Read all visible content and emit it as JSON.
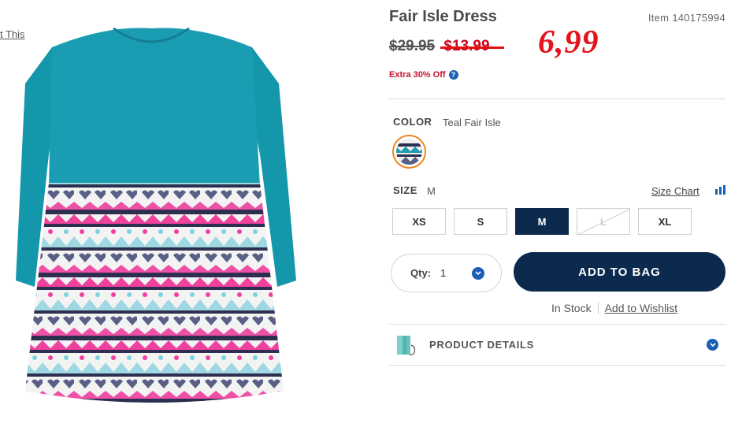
{
  "page": {
    "print_link": "t This"
  },
  "product": {
    "title": "Fair Isle Dress",
    "item_number": "Item 140175994",
    "price_original": "$29.95",
    "price_sale": "$13.99",
    "price_handwritten": "6,99",
    "extra_offer": "Extra 30% Off",
    "help_icon_glyph": "?"
  },
  "color": {
    "label": "COLOR",
    "value": "Teal Fair Isle",
    "swatch_icon": "fabric-swatch-icon"
  },
  "size": {
    "label": "SIZE",
    "selected": "M",
    "chart_label": "Size Chart",
    "options": [
      {
        "label": "XS",
        "state": "available"
      },
      {
        "label": "S",
        "state": "available"
      },
      {
        "label": "M",
        "state": "selected"
      },
      {
        "label": "L",
        "state": "unavailable"
      },
      {
        "label": "XL",
        "state": "available"
      }
    ]
  },
  "purchase": {
    "qty_label": "Qty:",
    "qty_value": "1",
    "add_to_bag": "ADD TO BAG",
    "stock_status": "In Stock",
    "wishlist": "Add to Wishlist"
  },
  "details": {
    "label": "PRODUCT DETAILS"
  },
  "colors": {
    "navy": "#0b2a4d",
    "accent_blue": "#1a5fb4",
    "sale_red": "#d0021b",
    "teal": "#1e9bb0",
    "swatch_ring": "#f0861e"
  }
}
